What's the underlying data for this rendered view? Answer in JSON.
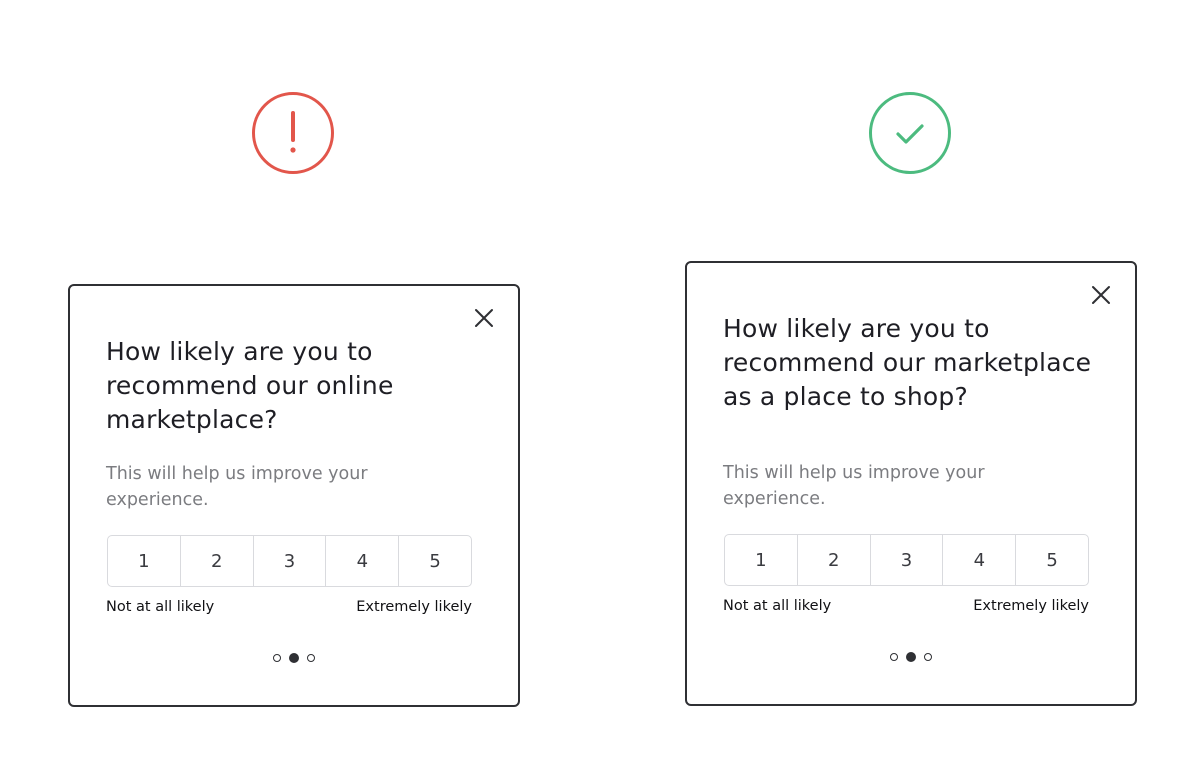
{
  "colors": {
    "bad": "#e2564b",
    "good": "#4cbb7f",
    "border": "#2f3034",
    "subtitle": "#7b7c80"
  },
  "bad_example": {
    "status_icon": "exclamation-circle-icon",
    "title": "How likely are you to recommend our online marketplace?",
    "subtitle": "This will help us improve your experience.",
    "scale": [
      "1",
      "2",
      "3",
      "4",
      "5"
    ],
    "low_label": "Not at all likely",
    "high_label": "Extremely likely",
    "pager": {
      "pages": 3,
      "current": 2
    }
  },
  "good_example": {
    "status_icon": "check-circle-icon",
    "title": "How likely are you to recommend our marketplace as a place to shop?",
    "subtitle": "This will help us improve your experience.",
    "scale": [
      "1",
      "2",
      "3",
      "4",
      "5"
    ],
    "low_label": "Not at all likely",
    "high_label": "Extremely likely",
    "pager": {
      "pages": 3,
      "current": 2
    }
  }
}
